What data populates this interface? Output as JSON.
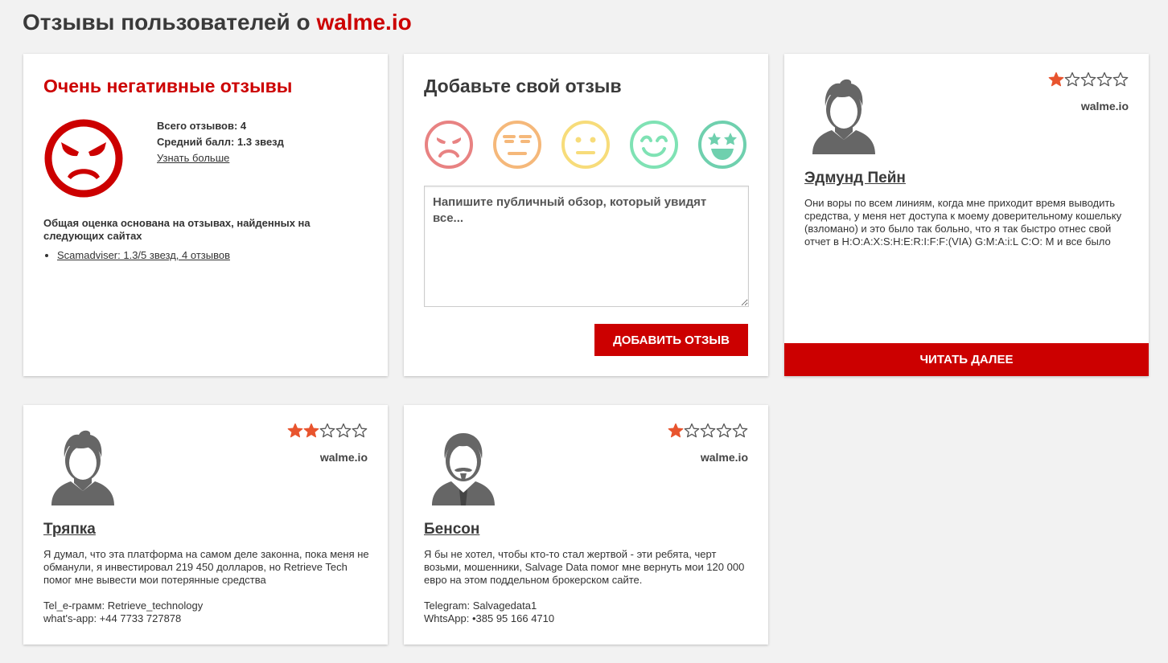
{
  "page": {
    "title_prefix": "Отзывы пользователей о ",
    "title_brand": "walme.io"
  },
  "summary": {
    "heading": "Очень негативные отзывы",
    "total_reviews": "Всего отзывов: 4",
    "average_score": "Средний балл: 1.3 звезд",
    "learn_more": "Узнать больше",
    "basis_text": "Общая оценка основана на отзывах, найденных на следующих сайтах",
    "sources": [
      {
        "label": "Scamadviser: 1.3/5 звезд, 4 отзывов"
      }
    ]
  },
  "add_review": {
    "heading": "Добавьте свой отзыв",
    "textarea_placeholder": "Напишите публичный обзор, который увидят все...",
    "submit_label": "ДОБАВИТЬ ОТЗЫВ",
    "emoji_options": [
      "angry-face-icon",
      "unamused-face-icon",
      "neutral-face-icon",
      "smiling-face-icon",
      "star-eyes-face-icon"
    ]
  },
  "reviews": [
    {
      "name": "Эдмунд Пейн",
      "rating": 1,
      "site": "walme.io",
      "text": "Они воры по всем линиям, когда мне приходит время выводить средства, у меня нет доступа к моему доверительному кошельку (взломано) и это было так больно, что я так быстро отнес свой отчет в H:O:A:X:S:H:E:R:I:F:F:(VIA) G:M:A:i:L C:O: M и все было",
      "read_more": "ЧИТАТЬ ДАЛЕЕ"
    },
    {
      "name": "Тряпка",
      "rating": 2,
      "site": "walme.io",
      "text": "Я думал, что эта платформа на самом деле законна, пока меня не обманули, я инвестировал 219 450 долларов, но Retrieve Tech помог мне вывести мои потерянные средства\n\nTel_e-грамм: Retrieve_technology\nwhat's-app: +44 7733 727878"
    },
    {
      "name": "Бенсон",
      "rating": 1,
      "site": "walme.io",
      "text": "Я бы не хотел, чтобы кто-то стал жертвой - эти ребята, черт возьми, мошенники, Salvage Data помог мне вернуть мои 120 000 евро на этом поддельном брокерском сайте.\n\nTelegram: Salvagedata1\nWhtsApp: •385 95 166 4710"
    }
  ],
  "colors": {
    "brand_red": "#cc0000",
    "star_filled": "#e8542e",
    "star_empty": "#555555"
  }
}
